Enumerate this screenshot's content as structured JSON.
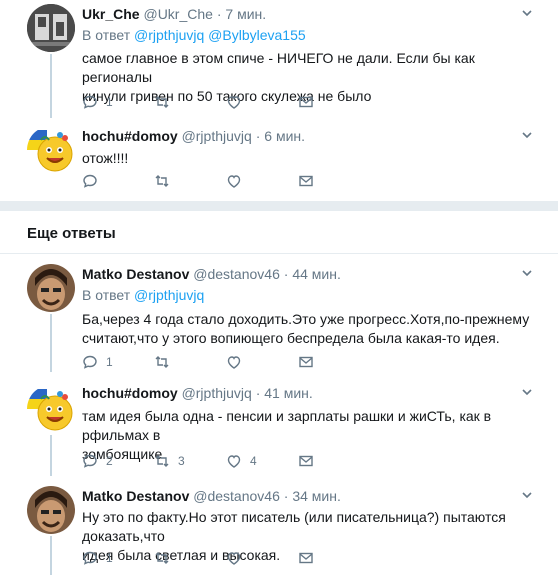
{
  "tweets_top": [
    {
      "name": "Ukr_Che",
      "handle": "@Ukr_Che",
      "time": "7 мин.",
      "reply_prefix": "В ответ",
      "reply_to_1": "@rjpthjuvjq",
      "reply_to_2": "@Bylbyleva155",
      "text_line1": "самое главное в этом спиче - НИЧЕГО не дали. Если бы как регионалы",
      "text_line2": "кинули гривен по 50 такого скулежа не было",
      "replies": "1",
      "retweets": "",
      "likes": ""
    },
    {
      "name": "hochu#domoy",
      "handle": "@rjpthjuvjq",
      "time": "6 мин.",
      "text_line1": "отож!!!!",
      "replies": "",
      "retweets": "",
      "likes": ""
    }
  ],
  "section": {
    "title": "Еще ответы"
  },
  "tweets_more": [
    {
      "name": "Matko Destanov",
      "handle": "@destanov46",
      "time": "44 мин.",
      "reply_prefix": "В ответ",
      "reply_to_1": "@rjpthjuvjq",
      "text_line1": "Ба,через 4 года стало доходить.Это уже прогресс.Хотя,по-прежнему",
      "text_line2": "считают,что у этого вопиющего беспредела была какая-то идея.",
      "replies": "1",
      "retweets": "",
      "likes": ""
    },
    {
      "name": "hochu#domoy",
      "handle": "@rjpthjuvjq",
      "time": "41 мин.",
      "text_line1": "там идея была одна - пенсии и зарплаты рашки и жиСТь, как в рфильмах в",
      "text_line2": "зомбоящике",
      "replies": "2",
      "retweets": "3",
      "likes": "4"
    },
    {
      "name": "Matko Destanov",
      "handle": "@destanov46",
      "time": "34 мин.",
      "text_line1": "Ну это по факту.Но этот писатель (или писательница?) пытаются доказать,что",
      "text_line2": "идея была светлая и высокая.",
      "replies": "1",
      "retweets": "",
      "likes": ""
    }
  ],
  "colors": {
    "link": "#1da1f2",
    "muted": "#657786",
    "thread_line": "#c4d5e0",
    "divider": "#e6ecf0"
  },
  "icons": [
    "chevron-down-icon",
    "reply-icon",
    "retweet-icon",
    "like-icon",
    "message-icon"
  ]
}
